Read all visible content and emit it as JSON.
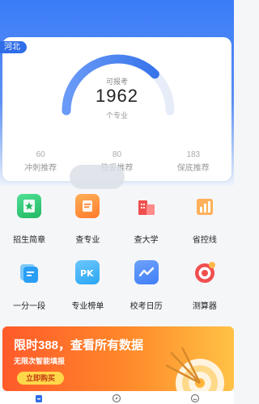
{
  "province": "河北",
  "gauge": {
    "caption": "可报考",
    "value": "1962",
    "unit": "个专业",
    "fill_fraction": 0.75
  },
  "stats": [
    {
      "num": "60",
      "label": "冲刺推荐"
    },
    {
      "num": "80",
      "label": "稳妥推荐"
    },
    {
      "num": "183",
      "label": "保底推荐"
    }
  ],
  "tools": [
    {
      "label": "招生简章",
      "icon": "book-star-icon",
      "color": "#2fcf7a"
    },
    {
      "label": "查专业",
      "icon": "document-icon",
      "color": "#ff8a2a"
    },
    {
      "label": "查大学",
      "icon": "building-icon",
      "color": "#f04e4e"
    },
    {
      "label": "省控线",
      "icon": "bar-chart-icon",
      "color": "#ff8a2a"
    },
    {
      "label": "一分一段",
      "icon": "cards-icon",
      "color": "#2a9ef5"
    },
    {
      "label": "专业榜单",
      "icon": "pk-icon",
      "color": "#2aa6f5"
    },
    {
      "label": "校考日历",
      "icon": "trend-calendar-icon",
      "color": "#3f7ef7"
    },
    {
      "label": "测算器",
      "icon": "target-icon",
      "color": "#f04e4e"
    }
  ],
  "banner": {
    "title": "限时388，查看所有数据",
    "subtitle": "无限次智能填报",
    "button": "立即购买"
  },
  "tabbar": [
    "home-icon",
    "compass-icon",
    "smile-icon"
  ]
}
